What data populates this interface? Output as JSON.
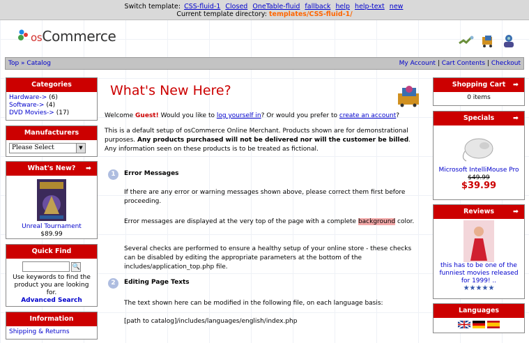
{
  "template_bar": {
    "switch_label": "Switch template:",
    "links": [
      "CSS-fluid-1",
      "Closed",
      "OneTable-fluid",
      "fallback",
      "help",
      "help-text",
      "new"
    ],
    "dir_label": "Current template directory:",
    "dir_value": "templates/CSS-fluid-1/"
  },
  "header": {
    "logo_prefix": "os",
    "logo_main": "Commerce",
    "icons": [
      "checkout-icon",
      "cart-icon",
      "account-icon"
    ]
  },
  "breadcrumb": {
    "path": "Top » Catalog",
    "links": [
      "My Account",
      "Cart Contents",
      "Checkout"
    ]
  },
  "left": {
    "categories": {
      "title": "Categories",
      "items": [
        {
          "name": "Hardware->",
          "count": "(6)"
        },
        {
          "name": "Software->",
          "count": "(4)"
        },
        {
          "name": "DVD Movies->",
          "count": "(17)"
        }
      ]
    },
    "manufacturers": {
      "title": "Manufacturers",
      "selected": "Please Select"
    },
    "whats_new": {
      "title": "What's New?",
      "arrow": "➡",
      "product": "Unreal Tournament",
      "price": "$89.99"
    },
    "quick_find": {
      "title": "Quick Find",
      "help": "Use keywords to find the product you are looking for.",
      "advanced": "Advanced Search"
    },
    "information": {
      "title": "Information",
      "first_link": "Shipping & Returns"
    }
  },
  "main": {
    "heading": "What's New Here?",
    "welcome_pre": "Welcome",
    "welcome_guest": "Guest!",
    "welcome_mid": "Would you like to",
    "login_link": "log yourself in",
    "welcome_or": "? Or would you prefer to",
    "create_link": "create an account",
    "welcome_end": "?",
    "intro_a": "This is a default setup of osCommerce Online Merchant. Products shown are for demonstrational purposes.",
    "intro_bold": "Any products purchased will not be delivered nor will the customer be billed",
    "intro_b": ". Any information seen on these products is to be treated as fictional.",
    "sections": [
      {
        "num": "1",
        "title": "Error Messages"
      },
      {
        "num": "2",
        "title": "Editing Page Texts"
      }
    ],
    "err_p1": "If there are any error or warning messages shown above, please correct them first before proceeding.",
    "err_p2_a": "Error messages are displayed at the very top of the page with a complete",
    "err_p2_hl": "background",
    "err_p2_b": "color.",
    "err_p3": "Several checks are performed to ensure a healthy setup of your online store - these checks can be disabled by editing the appropriate parameters at the bottom of the includes/application_top.php file.",
    "edit_p1": "The text shown here can be modified in the following file, on each language basis:",
    "edit_p2": "[path to catalog]/includes/languages/english/index.php"
  },
  "right": {
    "cart": {
      "title": "Shopping Cart",
      "arrow": "➡",
      "body": "0 items"
    },
    "specials": {
      "title": "Specials",
      "arrow": "➡",
      "product": "Microsoft IntelliMouse Pro",
      "old_price": "$49.99",
      "new_price": "$39.99"
    },
    "reviews": {
      "title": "Reviews",
      "arrow": "➡",
      "text": "this has to be one of the funniest movies released for 1999! ..",
      "stars": "★★★★★"
    },
    "languages": {
      "title": "Languages",
      "flags": [
        "uk-flag-icon",
        "de-flag-icon",
        "es-flag-icon"
      ]
    }
  },
  "colors": {
    "accent": "#cc0000",
    "link": "#0000cc",
    "dir": "#ff6600"
  }
}
